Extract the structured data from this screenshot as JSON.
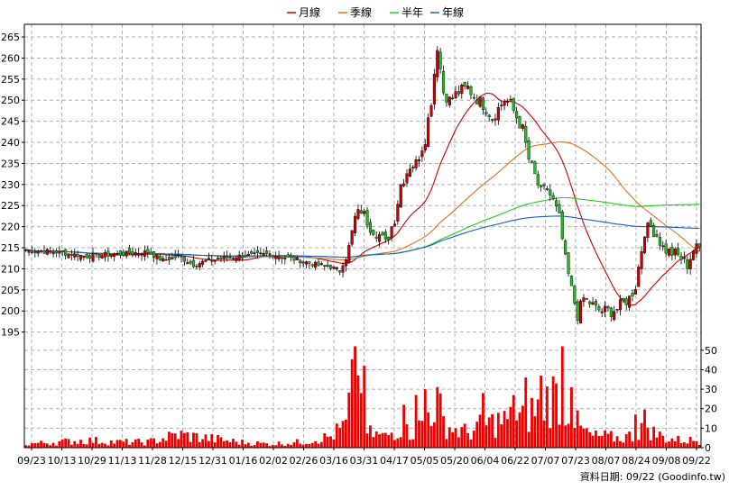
{
  "chart_data": {
    "type": "candlestick",
    "legend": {
      "placement": "top-center",
      "items": [
        {
          "name": "月線",
          "color": "#cc0000"
        },
        {
          "name": "季線",
          "color": "#e07020"
        },
        {
          "name": "半年",
          "color": "#22cc22"
        },
        {
          "name": "年線",
          "color": "#1a5fcc"
        }
      ]
    },
    "price_axis": {
      "min": 193,
      "max": 268,
      "ticks": [
        195,
        200,
        205,
        210,
        215,
        220,
        225,
        230,
        235,
        240,
        245,
        250,
        255,
        260,
        265
      ]
    },
    "volume_axis": {
      "min": 0,
      "max": 55,
      "ticks": [
        0,
        10,
        20,
        30,
        40,
        50
      ]
    },
    "x_ticks": [
      "09/23",
      "10/13",
      "10/29",
      "11/13",
      "11/28",
      "12/15",
      "12/31",
      "01/16",
      "02/02",
      "02/26",
      "03/16",
      "03/31",
      "04/17",
      "05/05",
      "05/20",
      "06/04",
      "06/22",
      "07/07",
      "07/23",
      "08/07",
      "08/24",
      "09/08",
      "09/22"
    ],
    "grid": true,
    "footer": "資料日期: 09/22 (Goodinfo.tw)",
    "colors": {
      "up": "#cc0000",
      "down": "#22bb22",
      "volume": "#ee0000",
      "grid": "#b0b0b0",
      "axis": "#000000"
    },
    "close_keypoints": [
      [
        0,
        214.5
      ],
      [
        10,
        214
      ],
      [
        20,
        213
      ],
      [
        30,
        213.5
      ],
      [
        40,
        214
      ],
      [
        45,
        212
      ],
      [
        50,
        213
      ],
      [
        55,
        211
      ],
      [
        60,
        212
      ],
      [
        70,
        213
      ],
      [
        80,
        213.5
      ],
      [
        90,
        212
      ],
      [
        95,
        211
      ],
      [
        100,
        210.5
      ],
      [
        103,
        209.5
      ],
      [
        106,
        215
      ],
      [
        108,
        222
      ],
      [
        110,
        224
      ],
      [
        113,
        220
      ],
      [
        116,
        218
      ],
      [
        118,
        216
      ],
      [
        121,
        222
      ],
      [
        123,
        230
      ],
      [
        126,
        234.5
      ],
      [
        128,
        235
      ],
      [
        131,
        241
      ],
      [
        133,
        250
      ],
      [
        135,
        263
      ],
      [
        137,
        252
      ],
      [
        139,
        250
      ],
      [
        142,
        252
      ],
      [
        145,
        253
      ],
      [
        147,
        251
      ],
      [
        150,
        249
      ],
      [
        153,
        246
      ],
      [
        155,
        248
      ],
      [
        157,
        250
      ],
      [
        159,
        249
      ],
      [
        161,
        246
      ],
      [
        163,
        243
      ],
      [
        165,
        236
      ],
      [
        167,
        232
      ],
      [
        169,
        228
      ],
      [
        171,
        229
      ],
      [
        173,
        226
      ],
      [
        175,
        222
      ],
      [
        177,
        212
      ],
      [
        179,
        205
      ],
      [
        181,
        199
      ],
      [
        183,
        203
      ],
      [
        185,
        202
      ],
      [
        187,
        200.5
      ],
      [
        189,
        200
      ],
      [
        192,
        200
      ],
      [
        194,
        200.5
      ],
      [
        196,
        202
      ],
      [
        198,
        203
      ],
      [
        200,
        206
      ],
      [
        203,
        219
      ],
      [
        205,
        220
      ],
      [
        207,
        218
      ],
      [
        209,
        215
      ],
      [
        211,
        214
      ],
      [
        213,
        213.5
      ],
      [
        215,
        212.5
      ],
      [
        217,
        211
      ],
      [
        219,
        214.5
      ],
      [
        221,
        215
      ]
    ],
    "volume_keypoints": [
      [
        0,
        2
      ],
      [
        10,
        3
      ],
      [
        20,
        4
      ],
      [
        30,
        3
      ],
      [
        40,
        3
      ],
      [
        50,
        7
      ],
      [
        60,
        5
      ],
      [
        70,
        3
      ],
      [
        80,
        2
      ],
      [
        90,
        3
      ],
      [
        100,
        6
      ],
      [
        105,
        12
      ],
      [
        107,
        30
      ],
      [
        109,
        14
      ],
      [
        112,
        8
      ],
      [
        118,
        6
      ],
      [
        122,
        10
      ],
      [
        126,
        8
      ],
      [
        130,
        12
      ],
      [
        133,
        22
      ],
      [
        135,
        24
      ],
      [
        137,
        14
      ],
      [
        140,
        10
      ],
      [
        145,
        8
      ],
      [
        150,
        12
      ],
      [
        155,
        14
      ],
      [
        160,
        15
      ],
      [
        165,
        18
      ],
      [
        170,
        25
      ],
      [
        175,
        30
      ],
      [
        178,
        20
      ],
      [
        182,
        10
      ],
      [
        186,
        6
      ],
      [
        190,
        6
      ],
      [
        195,
        5
      ],
      [
        200,
        7
      ],
      [
        203,
        14
      ],
      [
        206,
        8
      ],
      [
        210,
        5
      ],
      [
        215,
        4
      ],
      [
        221,
        4
      ]
    ],
    "volume_spikes": [
      [
        108,
        52
      ],
      [
        109,
        37
      ],
      [
        110,
        28
      ],
      [
        111,
        42
      ],
      [
        176,
        52
      ],
      [
        174,
        33
      ],
      [
        169,
        37
      ],
      [
        150,
        28
      ],
      [
        128,
        27
      ],
      [
        131,
        30
      ],
      [
        164,
        36
      ],
      [
        179,
        31
      ],
      [
        124,
        22
      ],
      [
        160,
        27
      ],
      [
        200,
        17
      ]
    ],
    "moving_averages": [
      {
        "name": "月線",
        "window": 20,
        "color": "#cc0000"
      },
      {
        "name": "季線",
        "window": 60,
        "color": "#e07020"
      },
      {
        "name": "半年",
        "window": 120,
        "color": "#22cc22"
      },
      {
        "name": "年線",
        "window": 240,
        "color": "#1a5fcc"
      }
    ]
  }
}
